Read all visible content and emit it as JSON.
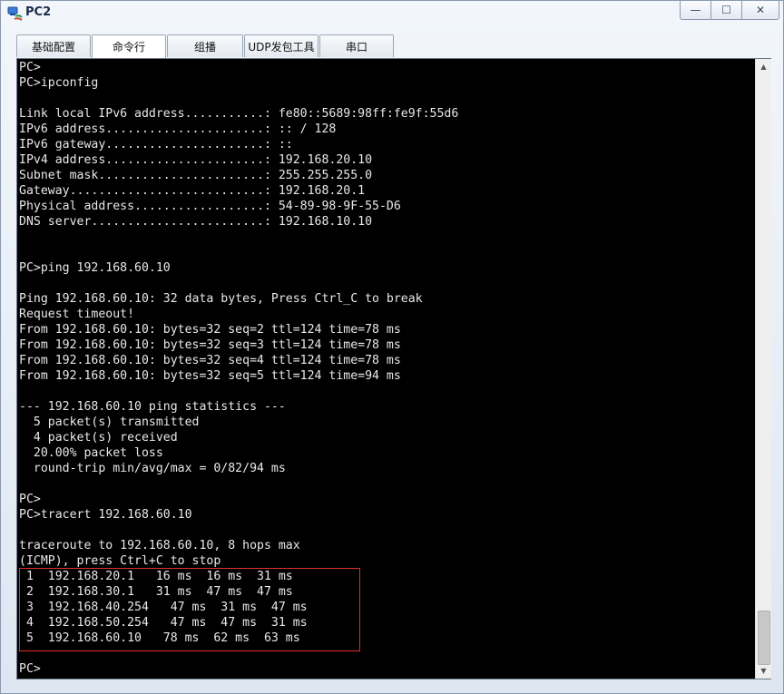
{
  "window": {
    "title": "PC2",
    "controls": {
      "minimize": "—",
      "maximize": "☐",
      "close": "✕"
    }
  },
  "tabs": [
    {
      "label": "基础配置"
    },
    {
      "label": "命令行"
    },
    {
      "label": "组播"
    },
    {
      "label": "UDP发包工具"
    },
    {
      "label": "串口"
    }
  ],
  "active_tab": "命令行",
  "terminal": {
    "lines": [
      "PC>",
      "PC>ipconfig",
      "",
      "Link local IPv6 address...........: fe80::5689:98ff:fe9f:55d6",
      "IPv6 address......................: :: / 128",
      "IPv6 gateway......................: ::",
      "IPv4 address......................: 192.168.20.10",
      "Subnet mask.......................: 255.255.255.0",
      "Gateway...........................: 192.168.20.1",
      "Physical address..................: 54-89-98-9F-55-D6",
      "DNS server........................: 192.168.10.10",
      "",
      "",
      "PC>ping 192.168.60.10",
      "",
      "Ping 192.168.60.10: 32 data bytes, Press Ctrl_C to break",
      "Request timeout!",
      "From 192.168.60.10: bytes=32 seq=2 ttl=124 time=78 ms",
      "From 192.168.60.10: bytes=32 seq=3 ttl=124 time=78 ms",
      "From 192.168.60.10: bytes=32 seq=4 ttl=124 time=78 ms",
      "From 192.168.60.10: bytes=32 seq=5 ttl=124 time=94 ms",
      "",
      "--- 192.168.60.10 ping statistics ---",
      "  5 packet(s) transmitted",
      "  4 packet(s) received",
      "  20.00% packet loss",
      "  round-trip min/avg/max = 0/82/94 ms",
      "",
      "PC>",
      "PC>tracert 192.168.60.10",
      "",
      "traceroute to 192.168.60.10, 8 hops max",
      "(ICMP), press Ctrl+C to stop",
      " 1  192.168.20.1   16 ms  16 ms  31 ms",
      " 2  192.168.30.1   31 ms  47 ms  47 ms",
      " 3  192.168.40.254   47 ms  31 ms  47 ms",
      " 4  192.168.50.254   47 ms  47 ms  31 ms",
      " 5  192.168.60.10   78 ms  62 ms  63 ms",
      "",
      "PC>"
    ]
  },
  "colors": {
    "terminal_bg": "#000000",
    "terminal_fg": "#e8e8e8",
    "highlight_border": "#e0302a"
  },
  "icons": {
    "app": "network-pc-icon",
    "scroll_up": "chevron-up-icon",
    "scroll_down": "chevron-down-icon"
  }
}
